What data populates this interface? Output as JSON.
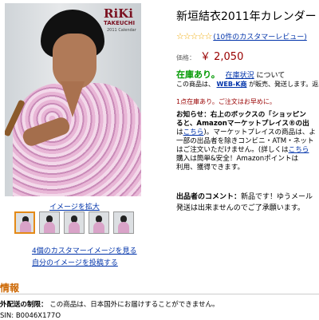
{
  "photo": {
    "logo_main": "RiKi",
    "logo_sub": "TAKEUCHI",
    "logo_small": "2011 Calendar"
  },
  "links": {
    "enlarge": "イメージを拡大",
    "customer_images": "4個のカスタマーイメージを見る",
    "post_image": "自分のイメージを投稿する"
  },
  "product": {
    "title": "新垣結衣2011年カレンダー",
    "stars": "☆☆☆☆☆",
    "review_count": "(10件のカスタマーレビュー)",
    "price_label": "価格：",
    "price": "￥ 2,050"
  },
  "stock": {
    "status": "在庫あり。",
    "link": "在庫状況",
    "suffix": "について",
    "seller_prefix": "この商品は、",
    "seller": "WEB-K商",
    "seller_suffix": "が販売、発送します。返品"
  },
  "warning": "1点在庫あり。ご注文はお早めに。",
  "notice": {
    "line1": "お知らせ：右上のボックスの「ショッピン",
    "line2": "ると、Amazonマーケットプレイス®の出",
    "line3_link": "こちら",
    "line3_rest": ")。マーケットプレイスの商品は、よ",
    "line4": "一部の出品者を除きコンビニ・ATM・ネット",
    "line5_pre": "はご注文いただけません。(詳しくは",
    "line5_link": "こちら",
    "line6": "購入は簡単&安全！Amazonポイントは",
    "line7": "利用、獲得できます。"
  },
  "comment": {
    "label": "出品者のコメント：",
    "line1": "新品です！ゆうメール",
    "line2": "発送は出来ませんのでご了承願います。"
  },
  "details": {
    "heading": "情報",
    "restriction_label": "外配送の制限：",
    "restriction_text": "この商品は、日本国外にお届けすることができません。",
    "asin": "SIN: B0046X177O"
  },
  "colors": {
    "link": "#0033aa",
    "price": "#990000",
    "in_stock": "#009900",
    "heading": "#cc6600",
    "star": "#f0a800"
  }
}
